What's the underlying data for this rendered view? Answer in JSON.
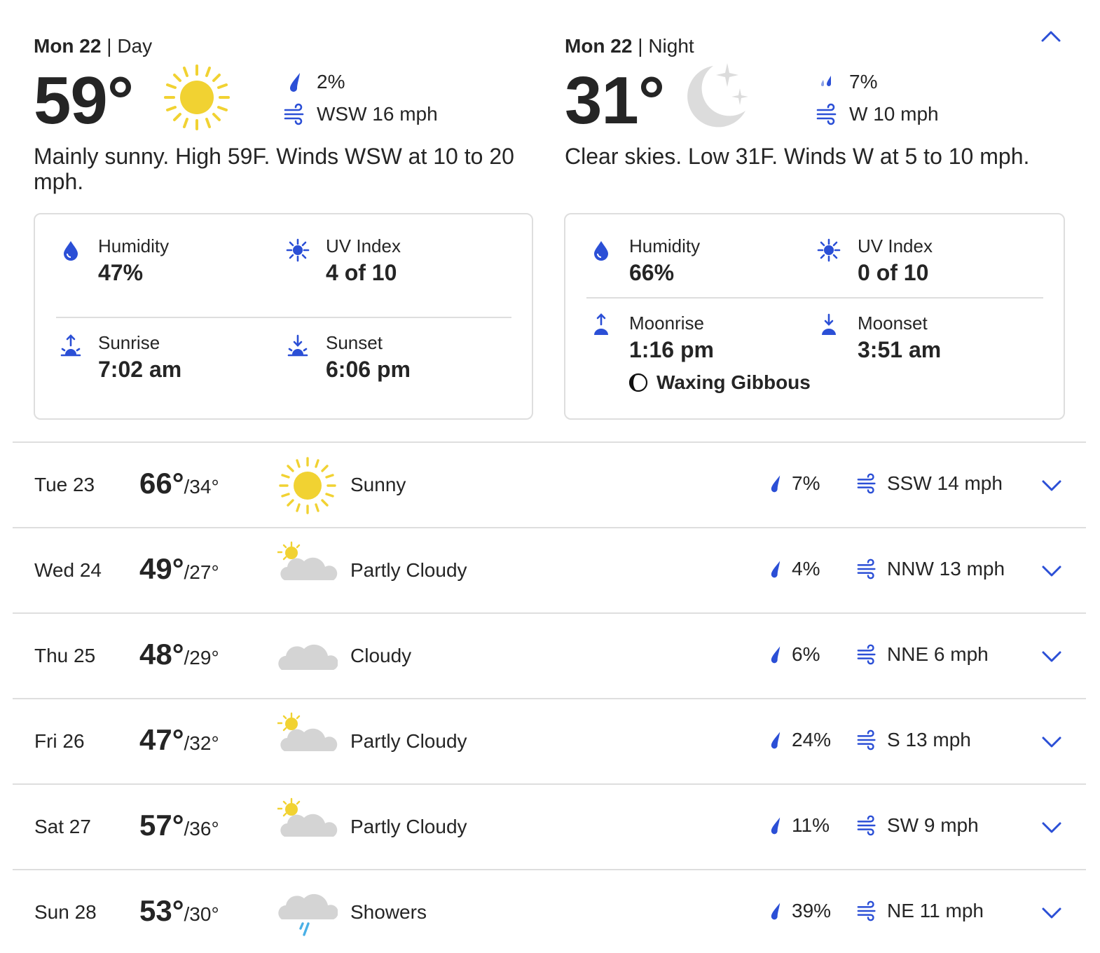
{
  "day": {
    "date": "Mon 22",
    "period": "Day",
    "temp": "59°",
    "precip": "2%",
    "wind": "WSW 16 mph",
    "narrative": "Mainly sunny. High 59F. Winds WSW at 10 to 20 mph.",
    "details": {
      "humidity_label": "Humidity",
      "humidity": "47%",
      "uv_label": "UV Index",
      "uv": "4 of 10",
      "sunrise_label": "Sunrise",
      "sunrise": "7:02 am",
      "sunset_label": "Sunset",
      "sunset": "6:06 pm"
    }
  },
  "night": {
    "date": "Mon 22",
    "period": "Night",
    "temp": "31°",
    "precip": "7%",
    "wind": "W 10 mph",
    "narrative": "Clear skies. Low 31F. Winds W at 5 to 10 mph.",
    "details": {
      "humidity_label": "Humidity",
      "humidity": "66%",
      "uv_label": "UV Index",
      "uv": "0 of 10",
      "moonrise_label": "Moonrise",
      "moonrise": "1:16 pm",
      "moonset_label": "Moonset",
      "moonset": "3:51 am",
      "moon_phase": "Waxing Gibbous"
    }
  },
  "separator": "|",
  "forecast": [
    {
      "day": "Tue 23",
      "hi": "66°",
      "lo": "/34°",
      "icon": "sunny-icon",
      "phrase": "Sunny",
      "precip": "7%",
      "wind": "SSW 14 mph"
    },
    {
      "day": "Wed 24",
      "hi": "49°",
      "lo": "/27°",
      "icon": "partly-cloudy-icon",
      "phrase": "Partly Cloudy",
      "precip": "4%",
      "wind": "NNW 13 mph"
    },
    {
      "day": "Thu 25",
      "hi": "48°",
      "lo": "/29°",
      "icon": "cloudy-icon",
      "phrase": "Cloudy",
      "precip": "6%",
      "wind": "NNE 6 mph"
    },
    {
      "day": "Fri 26",
      "hi": "47°",
      "lo": "/32°",
      "icon": "partly-cloudy-icon",
      "phrase": "Partly Cloudy",
      "precip": "24%",
      "wind": "S 13 mph"
    },
    {
      "day": "Sat 27",
      "hi": "57°",
      "lo": "/36°",
      "icon": "partly-cloudy-icon",
      "phrase": "Partly Cloudy",
      "precip": "11%",
      "wind": "SW 9 mph"
    },
    {
      "day": "Sun 28",
      "hi": "53°",
      "lo": "/30°",
      "icon": "showers-icon",
      "phrase": "Showers",
      "precip": "39%",
      "wind": "NE 11 mph"
    }
  ],
  "colors": {
    "accent": "#2b4fd6",
    "sun": "#f1d232",
    "cloud": "#d4d4d4",
    "text": "#252525"
  }
}
